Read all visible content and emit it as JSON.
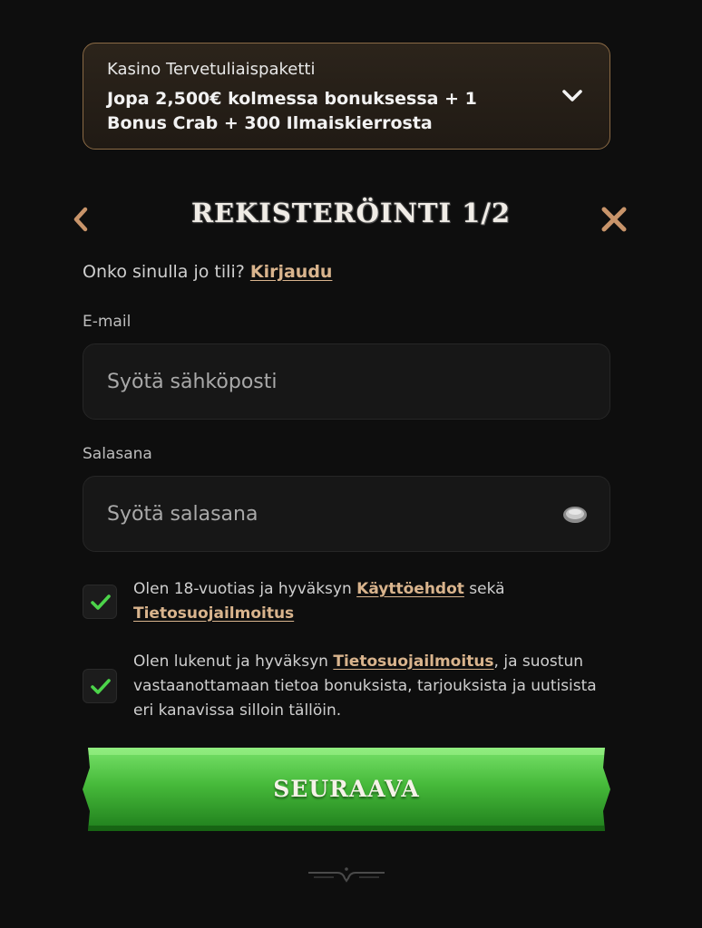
{
  "bonus": {
    "title": "Kasino Tervetuliaispaketti",
    "description": "Jopa 2,500€ kolmessa bonuksessa + 1 Bonus Crab + 300 Ilmaiskierrosta"
  },
  "header": {
    "title": "REKISTERÖINTI 1/2"
  },
  "account": {
    "question": "Onko sinulla jo tili?",
    "login_link": "Kirjaudu"
  },
  "form": {
    "email_label": "E-mail",
    "email_placeholder": "Syötä sähköposti",
    "password_label": "Salasana",
    "password_placeholder": "Syötä salasana"
  },
  "consents": {
    "terms": {
      "checked": true,
      "text_before": "Olen 18-vuotias ja hyväksyn ",
      "terms_link": "Käyttöehdot",
      "text_middle": " sekä ",
      "privacy_link": "Tietosuojailmoitus"
    },
    "marketing": {
      "checked": true,
      "text_before": "Olen lukenut ja hyväksyn ",
      "privacy_link": "Tietosuojailmoitus",
      "text_after": ", ja suostun vastaanottamaan tietoa bonuksista, tarjouksista ja uutisista eri kanavissa silloin tällöin."
    }
  },
  "submit": {
    "label": "SEURAAVA"
  },
  "colors": {
    "accent": "#d9b48d",
    "icon_accent": "#c8946a",
    "check_green": "#4cd44a",
    "button_green": "#3fae36"
  },
  "icons": {
    "back": "chevron-left-icon",
    "close": "close-icon",
    "expand": "chevron-down-icon",
    "password_visibility": "eye-icon"
  }
}
